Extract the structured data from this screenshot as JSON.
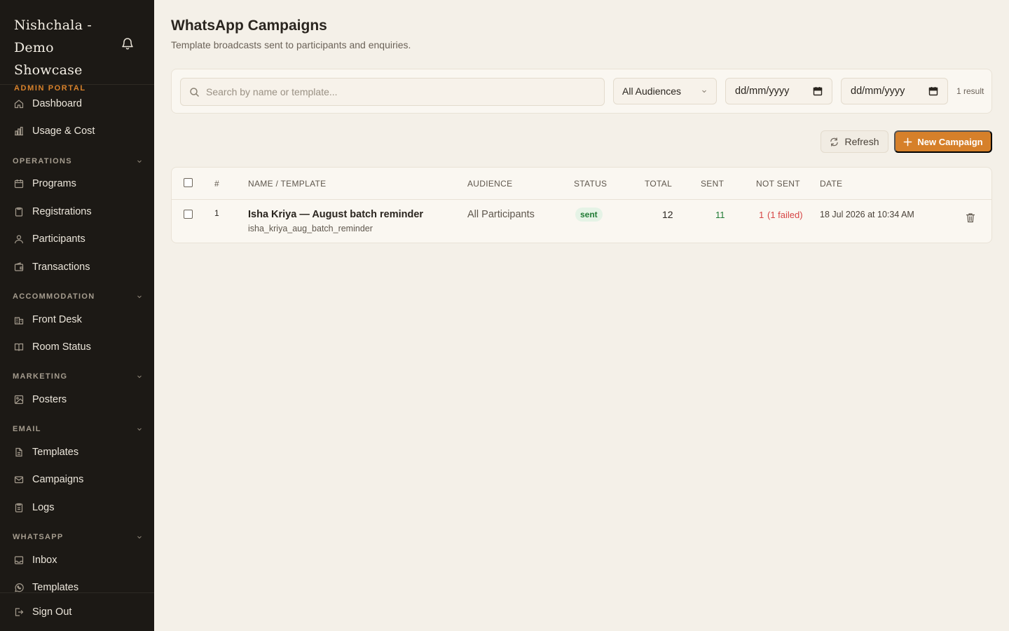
{
  "sidebar": {
    "brand_name": "Nishchala - Demo Showcase",
    "brand_line1": "Nishchala -",
    "brand_line2": "Demo Showcase",
    "portal_label": "ADMIN PORTAL",
    "top_items": [
      {
        "label": "Dashboard",
        "icon": "home-icon"
      },
      {
        "label": "Usage & Cost",
        "icon": "bar-chart-icon"
      }
    ],
    "sections": {
      "operations": {
        "title": "OPERATIONS",
        "items": [
          {
            "label": "Programs",
            "icon": "calendar-icon"
          },
          {
            "label": "Registrations",
            "icon": "clipboard-icon"
          },
          {
            "label": "Participants",
            "icon": "user-icon"
          },
          {
            "label": "Transactions",
            "icon": "wallet-icon"
          }
        ]
      },
      "accommodation": {
        "title": "ACCOMMODATION",
        "items": [
          {
            "label": "Front Desk",
            "icon": "hotel-icon"
          },
          {
            "label": "Room Status",
            "icon": "book-open-icon"
          }
        ]
      },
      "marketing": {
        "title": "MARKETING",
        "items": [
          {
            "label": "Posters",
            "icon": "image-icon"
          }
        ]
      },
      "email": {
        "title": "EMAIL",
        "items": [
          {
            "label": "Templates",
            "icon": "file-icon"
          },
          {
            "label": "Campaigns",
            "icon": "mail-icon"
          },
          {
            "label": "Logs",
            "icon": "clipboard-list-icon"
          }
        ]
      },
      "whatsapp": {
        "title": "WHATSAPP",
        "items": [
          {
            "label": "Inbox",
            "icon": "inbox-icon"
          },
          {
            "label": "Templates",
            "icon": "whatsapp-icon"
          }
        ]
      }
    },
    "sign_out": "Sign Out"
  },
  "main": {
    "title": "WhatsApp Campaigns",
    "subtitle": "Template broadcasts sent to participants and enquiries.",
    "filters": {
      "search_placeholder": "Search by name or template...",
      "audience_selected": "All Audiences",
      "date_from_placeholder": "dd/mm/yyyy",
      "date_to_placeholder": "dd/mm/yyyy",
      "result_count": "1 result"
    },
    "actions": {
      "refresh": "Refresh",
      "new_campaign": "New Campaign"
    },
    "table": {
      "headers": {
        "index": "#",
        "name": "NAME / TEMPLATE",
        "audience": "AUDIENCE",
        "status": "STATUS",
        "total": "TOTAL",
        "sent": "SENT",
        "not_sent": "NOT SENT",
        "date": "DATE"
      },
      "rows": [
        {
          "index": "1",
          "name": "Isha Kriya — August batch reminder",
          "template": "isha_kriya_aug_batch_reminder",
          "audience": "All Participants",
          "status": "sent",
          "total": "12",
          "sent": "11",
          "not_sent": "1",
          "not_sent_detail": "(1 failed)",
          "date": "18 Jul 2026 at 10:34 AM"
        }
      ]
    }
  },
  "colors": {
    "sidebar_bg": "#1c1915",
    "page_bg": "#f4f0e8",
    "accent": "#d6802a",
    "success": "#1f7a34",
    "danger": "#d64545"
  }
}
